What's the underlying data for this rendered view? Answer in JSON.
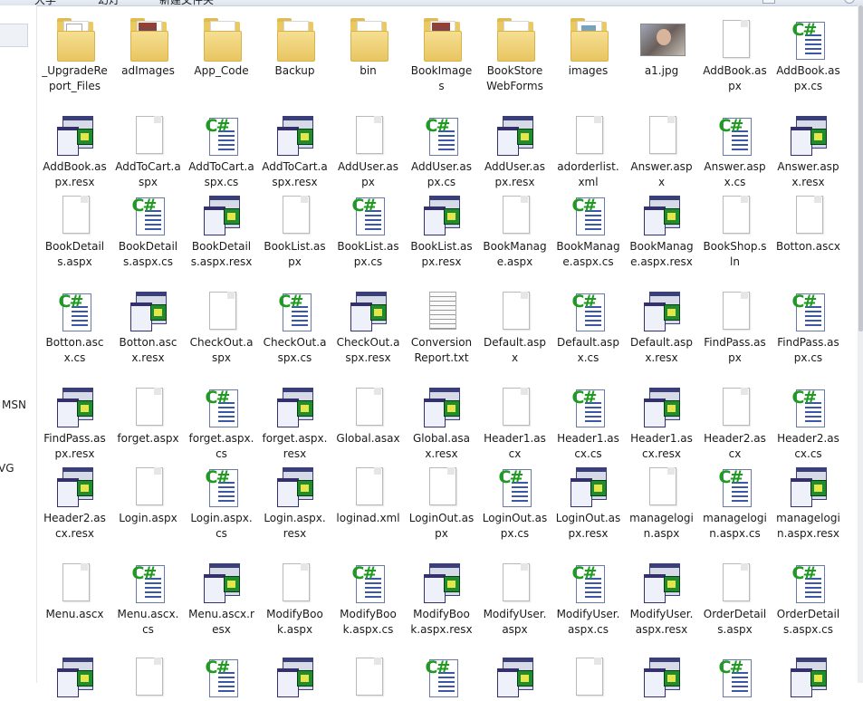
{
  "toolbar": {
    "items": [
      "大学",
      "幻灯",
      "新建文件夹"
    ]
  },
  "nav": {
    "labels": [
      "MSN",
      "VG"
    ]
  },
  "files": [
    {
      "name": "_UpgradeReport_Files",
      "type": "folder",
      "variant": "doc"
    },
    {
      "name": "adImages",
      "type": "folder",
      "variant": "img"
    },
    {
      "name": "App_Code",
      "type": "folder",
      "variant": "plain"
    },
    {
      "name": "Backup",
      "type": "folder",
      "variant": "plain"
    },
    {
      "name": "bin",
      "type": "folder",
      "variant": "plain"
    },
    {
      "name": "BookImages",
      "type": "folder",
      "variant": "img"
    },
    {
      "name": "BookStoreWebForms",
      "type": "folder",
      "variant": "plain"
    },
    {
      "name": "images",
      "type": "folder",
      "variant": "img2"
    },
    {
      "name": "a1.jpg",
      "type": "jpg"
    },
    {
      "name": "AddBook.aspx",
      "type": "blank"
    },
    {
      "name": "AddBook.aspx.cs",
      "type": "cs"
    },
    {
      "name": "AddBook.aspx.resx",
      "type": "resx"
    },
    {
      "name": "AddToCart.aspx",
      "type": "blank"
    },
    {
      "name": "AddToCart.aspx.cs",
      "type": "cs"
    },
    {
      "name": "AddToCart.aspx.resx",
      "type": "resx"
    },
    {
      "name": "AddUser.aspx",
      "type": "blank"
    },
    {
      "name": "AddUser.aspx.cs",
      "type": "cs"
    },
    {
      "name": "AddUser.aspx.resx",
      "type": "resx"
    },
    {
      "name": "adorderlist.xml",
      "type": "blank"
    },
    {
      "name": "Answer.aspx",
      "type": "blank"
    },
    {
      "name": "Answer.aspx.cs",
      "type": "cs"
    },
    {
      "name": "Answer.aspx.resx",
      "type": "resx"
    },
    {
      "name": "BookDetails.aspx",
      "type": "blank"
    },
    {
      "name": "BookDetails.aspx.cs",
      "type": "cs"
    },
    {
      "name": "BookDetails.aspx.resx",
      "type": "resx"
    },
    {
      "name": "BookList.aspx",
      "type": "blank"
    },
    {
      "name": "BookList.aspx.cs",
      "type": "cs"
    },
    {
      "name": "BookList.aspx.resx",
      "type": "resx"
    },
    {
      "name": "BookManage.aspx",
      "type": "blank"
    },
    {
      "name": "BookManage.aspx.cs",
      "type": "cs"
    },
    {
      "name": "BookManage.aspx.resx",
      "type": "resx"
    },
    {
      "name": "BookShop.sln",
      "type": "blank"
    },
    {
      "name": "Botton.ascx",
      "type": "blank"
    },
    {
      "name": "Botton.ascx.cs",
      "type": "cs"
    },
    {
      "name": "Botton.ascx.resx",
      "type": "resx"
    },
    {
      "name": "CheckOut.aspx",
      "type": "blank"
    },
    {
      "name": "CheckOut.aspx.cs",
      "type": "cs"
    },
    {
      "name": "CheckOut.aspx.resx",
      "type": "resx"
    },
    {
      "name": "ConversionReport.txt",
      "type": "txt"
    },
    {
      "name": "Default.aspx",
      "type": "blank"
    },
    {
      "name": "Default.aspx.cs",
      "type": "cs"
    },
    {
      "name": "Default.aspx.resx",
      "type": "resx"
    },
    {
      "name": "FindPass.aspx",
      "type": "blank"
    },
    {
      "name": "FindPass.aspx.cs",
      "type": "cs"
    },
    {
      "name": "FindPass.aspx.resx",
      "type": "resx"
    },
    {
      "name": "forget.aspx",
      "type": "blank"
    },
    {
      "name": "forget.aspx.cs",
      "type": "cs"
    },
    {
      "name": "forget.aspx.resx",
      "type": "resx"
    },
    {
      "name": "Global.asax",
      "type": "blank"
    },
    {
      "name": "Global.asax.resx",
      "type": "resx"
    },
    {
      "name": "Header1.ascx",
      "type": "blank"
    },
    {
      "name": "Header1.ascx.cs",
      "type": "cs"
    },
    {
      "name": "Header1.ascx.resx",
      "type": "resx"
    },
    {
      "name": "Header2.ascx",
      "type": "blank"
    },
    {
      "name": "Header2.ascx.cs",
      "type": "cs"
    },
    {
      "name": "Header2.ascx.resx",
      "type": "resx"
    },
    {
      "name": "Login.aspx",
      "type": "blank"
    },
    {
      "name": "Login.aspx.cs",
      "type": "cs"
    },
    {
      "name": "Login.aspx.resx",
      "type": "resx"
    },
    {
      "name": "loginad.xml",
      "type": "blank"
    },
    {
      "name": "LoginOut.aspx",
      "type": "blank"
    },
    {
      "name": "LoginOut.aspx.cs",
      "type": "cs"
    },
    {
      "name": "LoginOut.aspx.resx",
      "type": "resx"
    },
    {
      "name": "managelogin.aspx",
      "type": "blank"
    },
    {
      "name": "managelogin.aspx.cs",
      "type": "cs"
    },
    {
      "name": "managelogin.aspx.resx",
      "type": "resx"
    },
    {
      "name": "Menu.ascx",
      "type": "blank"
    },
    {
      "name": "Menu.ascx.cs",
      "type": "cs"
    },
    {
      "name": "Menu.ascx.resx",
      "type": "resx"
    },
    {
      "name": "ModifyBook.aspx",
      "type": "blank"
    },
    {
      "name": "ModifyBook.aspx.cs",
      "type": "cs"
    },
    {
      "name": "ModifyBook.aspx.resx",
      "type": "resx"
    },
    {
      "name": "ModifyUser.aspx",
      "type": "blank"
    },
    {
      "name": "ModifyUser.aspx.cs",
      "type": "cs"
    },
    {
      "name": "ModifyUser.aspx.resx",
      "type": "resx"
    },
    {
      "name": "OrderDetails.aspx",
      "type": "blank"
    },
    {
      "name": "OrderDetails.aspx.cs",
      "type": "cs"
    },
    {
      "name": "",
      "type": "resx"
    },
    {
      "name": "",
      "type": "blank"
    },
    {
      "name": "",
      "type": "cs"
    },
    {
      "name": "",
      "type": "resx"
    },
    {
      "name": "",
      "type": "blank"
    },
    {
      "name": "",
      "type": "cs"
    },
    {
      "name": "",
      "type": "resx"
    },
    {
      "name": "",
      "type": "blank"
    },
    {
      "name": "",
      "type": "resx"
    },
    {
      "name": "",
      "type": "cs"
    },
    {
      "name": "",
      "type": "resx"
    }
  ]
}
